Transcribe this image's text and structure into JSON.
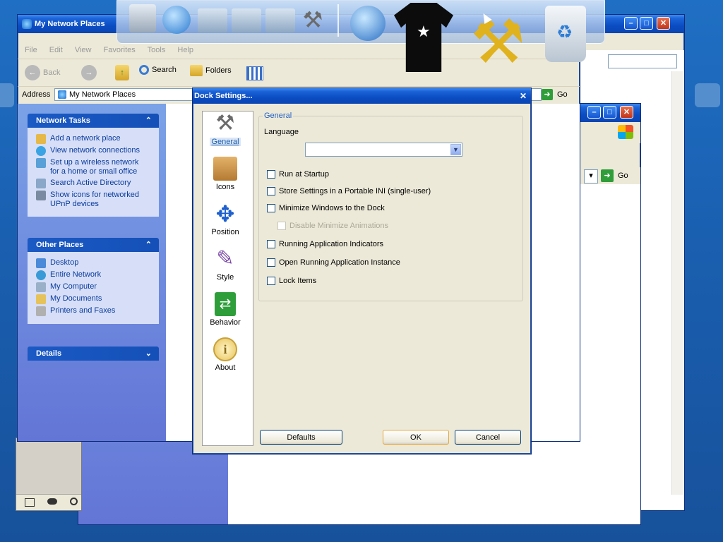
{
  "explorer": {
    "title": "My Network Places",
    "menu": [
      "File",
      "Edit",
      "View",
      "Favorites",
      "Tools",
      "Help"
    ],
    "toolbar": {
      "back": "Back",
      "search": "Search",
      "folders": "Folders"
    },
    "address_label": "Address",
    "address_value": "My Network Places",
    "go": "Go",
    "network_tasks": {
      "title": "Network Tasks",
      "items": [
        "Add a network place",
        "View network connections",
        "Set up a wireless network\nfor a home or small office",
        "Search Active Directory",
        "Show icons for networked\nUPnP devices"
      ]
    },
    "other_places": {
      "title": "Other Places",
      "items": [
        "Desktop",
        "Entire Network",
        "My Computer",
        "My Documents",
        "Printers and Faxes"
      ]
    },
    "details": {
      "title": "Details"
    }
  },
  "back_window": {
    "go": "Go"
  },
  "dialog": {
    "title": "Dock Settings...",
    "close": "✕",
    "sidebar": [
      "General",
      "Icons",
      "Position",
      "Style",
      "Behavior",
      "About"
    ],
    "group_title": "General",
    "language_label": "Language",
    "language_value": "",
    "options": [
      {
        "label": "Run at Startup",
        "checked": false,
        "enabled": true
      },
      {
        "label": "Store Settings in a Portable INI (single-user)",
        "checked": false,
        "enabled": true
      },
      {
        "label": "Minimize Windows to the Dock",
        "checked": false,
        "enabled": true
      },
      {
        "label": "Disable Minimize Animations",
        "checked": false,
        "enabled": false
      },
      {
        "label": "Running Application Indicators",
        "checked": false,
        "enabled": true
      },
      {
        "label": "Open Running Application Instance",
        "checked": false,
        "enabled": true
      },
      {
        "label": "Lock Items",
        "checked": false,
        "enabled": true
      }
    ],
    "buttons": {
      "defaults": "Defaults",
      "ok": "OK",
      "cancel": "Cancel"
    }
  },
  "colors": {
    "accent": "#0b4cc2",
    "desktop": "#1a5fb0",
    "taskpane": "#6375d6"
  }
}
